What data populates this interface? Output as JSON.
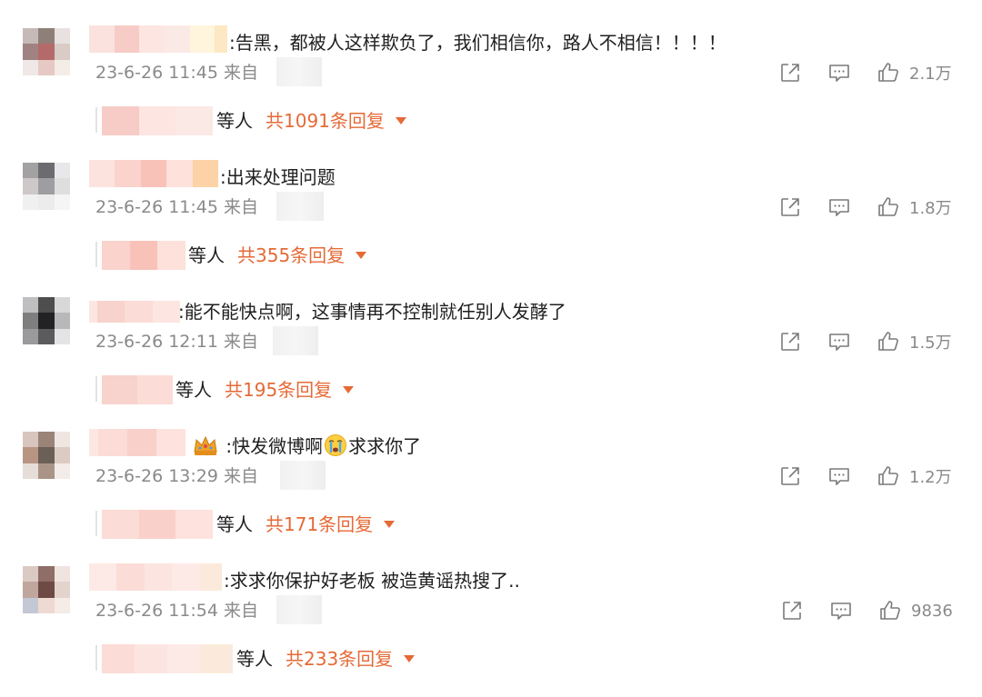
{
  "comments": [
    {
      "text": ":告黑，都被人这样欺负了，我们相信你，路人不相信！！！！",
      "time": "23-6-26 11:45",
      "source_prefix": "来自",
      "likes": "2.1万",
      "reply_who": "等人",
      "reply_count": "共1091条回复",
      "avatar_colors": [
        "#c6bab8",
        "#8f7f79",
        "#e8e1df",
        "#a08282",
        "#b56a6a",
        "#d9cbc5",
        "#efe8e6",
        "#e6c9c4",
        "#f4ece6"
      ],
      "name_colors": [
        "#fbe2de",
        "#f7ccc6",
        "#fde5e1",
        "#fbe9e6",
        "#fff4dc",
        "#fde8c4"
      ]
    },
    {
      "text": ":出来处理问题",
      "time": "23-6-26 11:45",
      "source_prefix": "来自",
      "likes": "1.8万",
      "reply_who": "等人",
      "reply_count": "共355条回复",
      "avatar_colors": [
        "#a4a1a3",
        "#6c6c70",
        "#e8e8ea",
        "#cfc8c8",
        "#9e9ea2",
        "#dedede",
        "#f0f0f0",
        "#ececec",
        "#f5f5f5"
      ],
      "name_colors": [
        "#fce3dd",
        "#fad3cc",
        "#f8c2b9",
        "#fde1da",
        "#fdd2a6"
      ]
    },
    {
      "text": ":能不能快点啊，这事情再不控制就任别人发酵了",
      "time": "23-6-26 12:11",
      "source_prefix": "来自",
      "likes": "1.5万",
      "reply_who": "等人",
      "reply_count": "共195条回复",
      "avatar_colors": [
        "#bfbfc1",
        "#4e4e4f",
        "#d8d8d9",
        "#7e7e7f",
        "#222224",
        "#b8b8ba",
        "#9a9a9c",
        "#5b5b5d",
        "#e4e4e6"
      ],
      "name_colors": [
        "#fbe6e2",
        "#f8d2cc",
        "#fcdcd6",
        "#fde5e2"
      ]
    },
    {
      "text_before": ":快发微博啊",
      "text_after": "求求你了",
      "time": "23-6-26 13:29",
      "source_prefix": "来自",
      "likes": "1.2万",
      "reply_who": "等人",
      "reply_count": "共171条回复",
      "avatar_colors": [
        "#d8c6be",
        "#9a8478",
        "#efe6e2",
        "#b89583",
        "#6c5f58",
        "#dccbc3",
        "#e7ddd8",
        "#aa9488",
        "#f3ece8"
      ],
      "name_colors": [
        "#fde7e3",
        "#fbdcd6",
        "#fad0ca",
        "#fde2de"
      ]
    },
    {
      "text": ":求求你保护好老板 被造黄谣热搜了..",
      "time": "23-6-26 11:54",
      "source_prefix": "来自",
      "likes": "9836",
      "reply_who": "等人",
      "reply_count": "共233条回复",
      "avatar_colors": [
        "#dacac3",
        "#8e6e66",
        "#efe4e0",
        "#c1a69d",
        "#6e4a44",
        "#e2d3cd",
        "#c4c8d4",
        "#eedad3",
        "#f5ebe7"
      ],
      "name_colors": [
        "#fde9e5",
        "#fbdcd7",
        "#fce5e0",
        "#fdeae6",
        "#fbeadb"
      ]
    }
  ],
  "icons": [
    "share-icon",
    "comment-icon",
    "like-icon"
  ]
}
